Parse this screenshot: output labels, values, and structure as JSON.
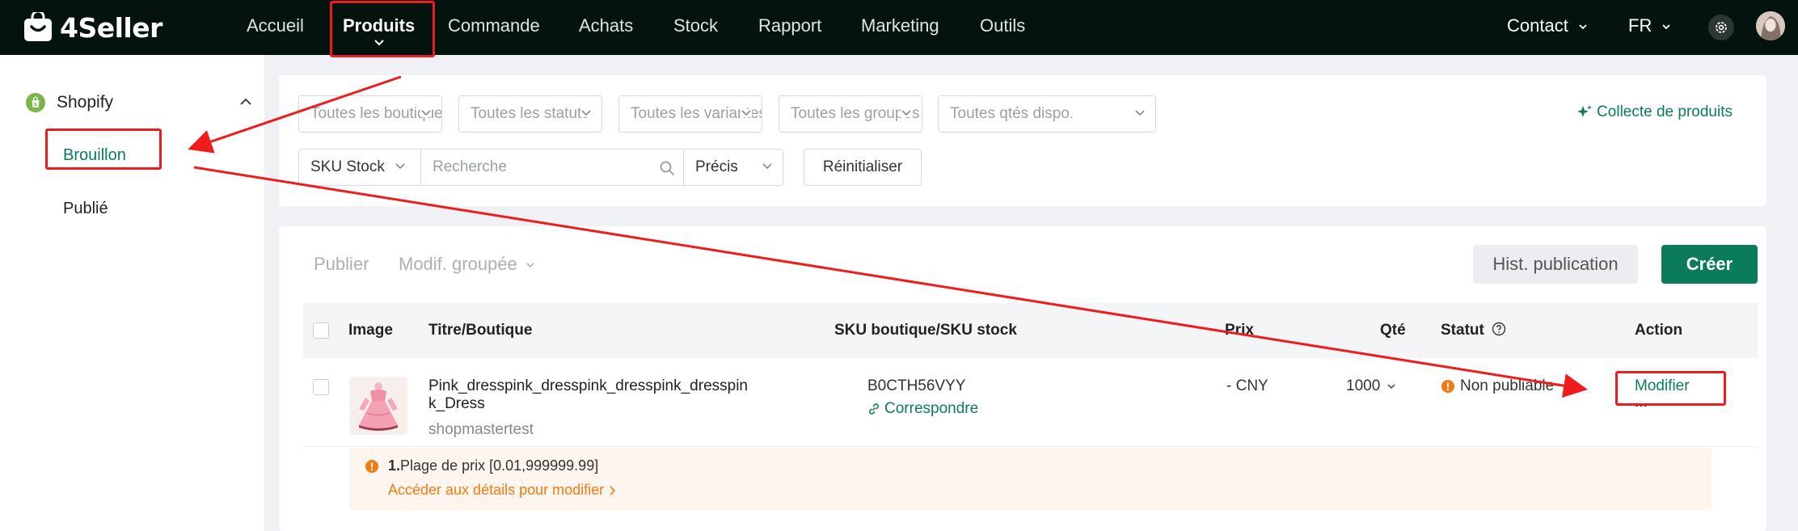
{
  "brand": {
    "name": "4Seller"
  },
  "nav": {
    "items": [
      "Accueil",
      "Produits",
      "Commande",
      "Achats",
      "Stock",
      "Rapport",
      "Marketing",
      "Outils"
    ],
    "active": "Produits",
    "contact_label": "Contact",
    "language_label": "FR"
  },
  "sidebar": {
    "platform": "Shopify",
    "items": [
      "Brouillon",
      "Publié"
    ],
    "active": "Brouillon"
  },
  "filters": {
    "shop_select": "Toutes les boutiques",
    "status_select": "Toutes les statuts",
    "variant_select": "Toutes les variantes",
    "group_select": "Toutes les groupes",
    "qty_select": "Toutes qtés dispo.",
    "collect_link": "Collecte de produits",
    "sku_type": "SKU Stock",
    "search_placeholder": "Recherche",
    "match_mode": "Précis",
    "reset_label": "Réinitialiser"
  },
  "toolbar": {
    "publish_label": "Publier",
    "bulk_edit_label": "Modif. groupée",
    "history_label": "Hist. publication",
    "create_label": "Créer"
  },
  "table": {
    "headers": {
      "image": "Image",
      "title": "Titre/Boutique",
      "sku": "SKU boutique/SKU stock",
      "price": "Prix",
      "qty": "Qté",
      "status": "Statut",
      "action": "Action"
    },
    "rows": [
      {
        "title_line1": "Pink_dresspink_dresspink_dresspink_dresspin",
        "title_line2": "k_Dress",
        "shop": "shopmastertest",
        "sku": "B0CTH56VYY",
        "match_label": "Correspondre",
        "price": "- CNY",
        "qty": "1000",
        "status": "Non publiable",
        "action_edit": "Modifier",
        "action_more": "...",
        "error": {
          "number": "1.",
          "message": "Plage de prix [0.01,999999.99]",
          "link": "Accéder aux détails pour modifier"
        }
      }
    ]
  },
  "colors": {
    "topbar": "#05130f",
    "brand_green": "#0a7c5c",
    "highlight_red": "#ee1c1c",
    "warning_orange": "#f07c12",
    "error_bg": "#fdf5ee"
  }
}
